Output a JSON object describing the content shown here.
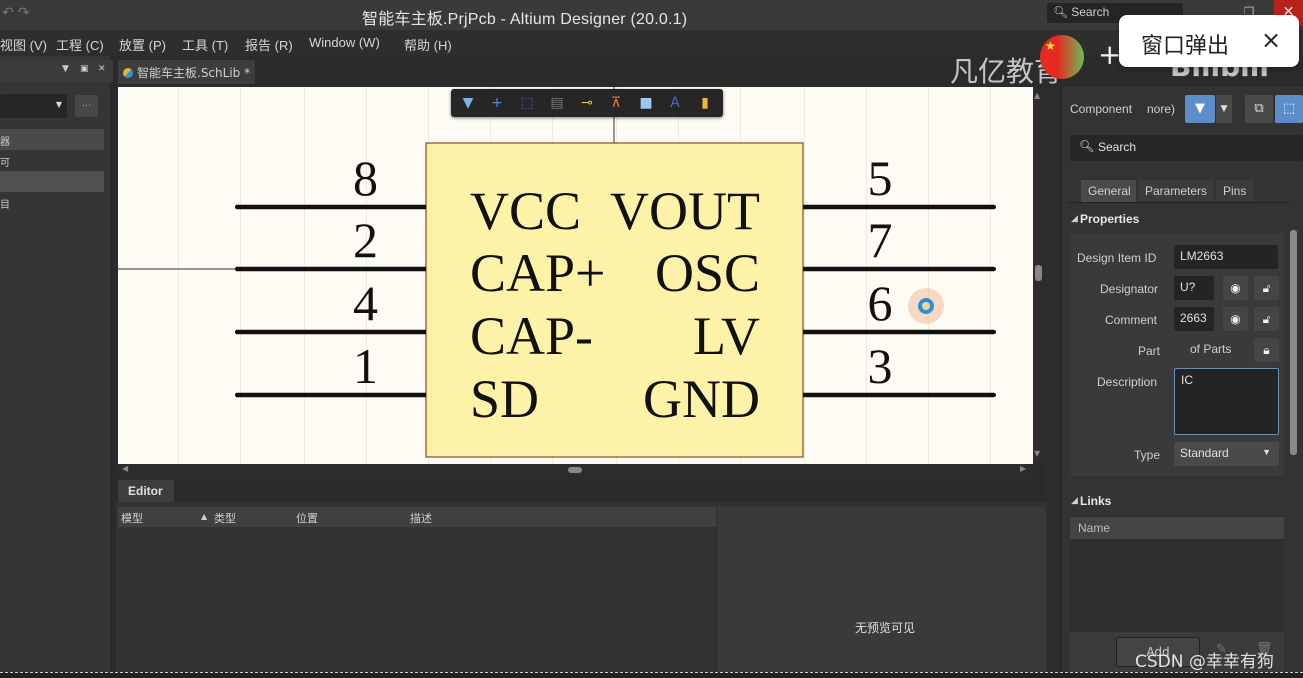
{
  "window": {
    "title": "智能车主板.PrjPcb - Altium Designer (20.0.1)",
    "search_placeholder": "Search",
    "undo_icon": "undo-icon",
    "redo_icon": "redo-icon"
  },
  "menu": [
    {
      "label": "视图 (V)"
    },
    {
      "label": "工程 (C)"
    },
    {
      "label": "放置 (P)"
    },
    {
      "label": "工具 (T)"
    },
    {
      "label": "报告 (R)"
    },
    {
      "label": "Window (W)"
    },
    {
      "label": "帮助 (H)"
    }
  ],
  "left_panel": {
    "combo_value": "",
    "browse_label": "...",
    "rows": [
      {
        "label": "器",
        "selected": true
      },
      {
        "label": "可",
        "selected": false
      },
      {
        "label": "",
        "selected": true
      },
      {
        "label": "目",
        "selected": false
      }
    ]
  },
  "document_tab": {
    "label": "智能车主板.SchLib *"
  },
  "active_bar": {
    "tools": [
      {
        "name": "filter-icon",
        "glyph": "▼",
        "color": "#7fb2e5"
      },
      {
        "name": "crosshair-icon",
        "glyph": "+",
        "color": "#5b86d6"
      },
      {
        "name": "select-rect-icon",
        "glyph": "⬚",
        "color": "#5360c9"
      },
      {
        "name": "align-icon",
        "glyph": "▤",
        "color": "#777777"
      },
      {
        "name": "pin-icon",
        "glyph": "⊸",
        "color": "#e3c050"
      },
      {
        "name": "ieee-symbol-icon",
        "glyph": "⊼",
        "color": "#e27b32"
      },
      {
        "name": "rectangle-icon",
        "glyph": "■",
        "color": "#9ec8ec"
      },
      {
        "name": "text-icon",
        "glyph": "A",
        "color": "#3d6cc9"
      },
      {
        "name": "part-icon",
        "glyph": "▮",
        "color": "#e8b83a"
      }
    ]
  },
  "component": {
    "fill_color": "#fdf3a8",
    "border_color": "#8a4a2a",
    "left_pins": [
      {
        "number": "8",
        "name": "VCC"
      },
      {
        "number": "2",
        "name": "CAP+"
      },
      {
        "number": "4",
        "name": "CAP-"
      },
      {
        "number": "1",
        "name": "SD"
      }
    ],
    "right_pins": [
      {
        "number": "5",
        "name": "VOUT"
      },
      {
        "number": "7",
        "name": "OSC"
      },
      {
        "number": "6",
        "name": "LV"
      },
      {
        "number": "3",
        "name": "GND"
      }
    ]
  },
  "overlay": {
    "watermark_text": "凡亿教育",
    "watermark_brand": "Bilibili",
    "logo_text": "凡亿",
    "popup_label": "窗口弹出",
    "popup_close": "×",
    "csdn_credit": "CSDN @幸幸有狗"
  },
  "editor": {
    "tab_label": "Editor",
    "columns": [
      "模型",
      "类型",
      "位置",
      "描述"
    ],
    "rows": [],
    "preview_message": "无预览可见"
  },
  "properties_panel": {
    "header_label": "Component",
    "header_suffix": "nore)",
    "search_placeholder": "Search",
    "tabs": [
      {
        "label": "General",
        "active": true
      },
      {
        "label": "Parameters",
        "active": false
      },
      {
        "label": "Pins",
        "active": false
      }
    ],
    "section_properties": "Properties",
    "fields": {
      "design_item_id_label": "Design Item ID",
      "design_item_id_value": "LM2663",
      "designator_label": "Designator",
      "designator_value": "U?",
      "comment_label": "Comment",
      "comment_value": "2663",
      "part_label": "Part",
      "part_value": "of Parts",
      "description_label": "Description",
      "description_value": "IC",
      "type_label": "Type",
      "type_value": "Standard"
    },
    "section_links": "Links",
    "links_column": "Name",
    "links_rows": [],
    "add_label": "Add"
  }
}
